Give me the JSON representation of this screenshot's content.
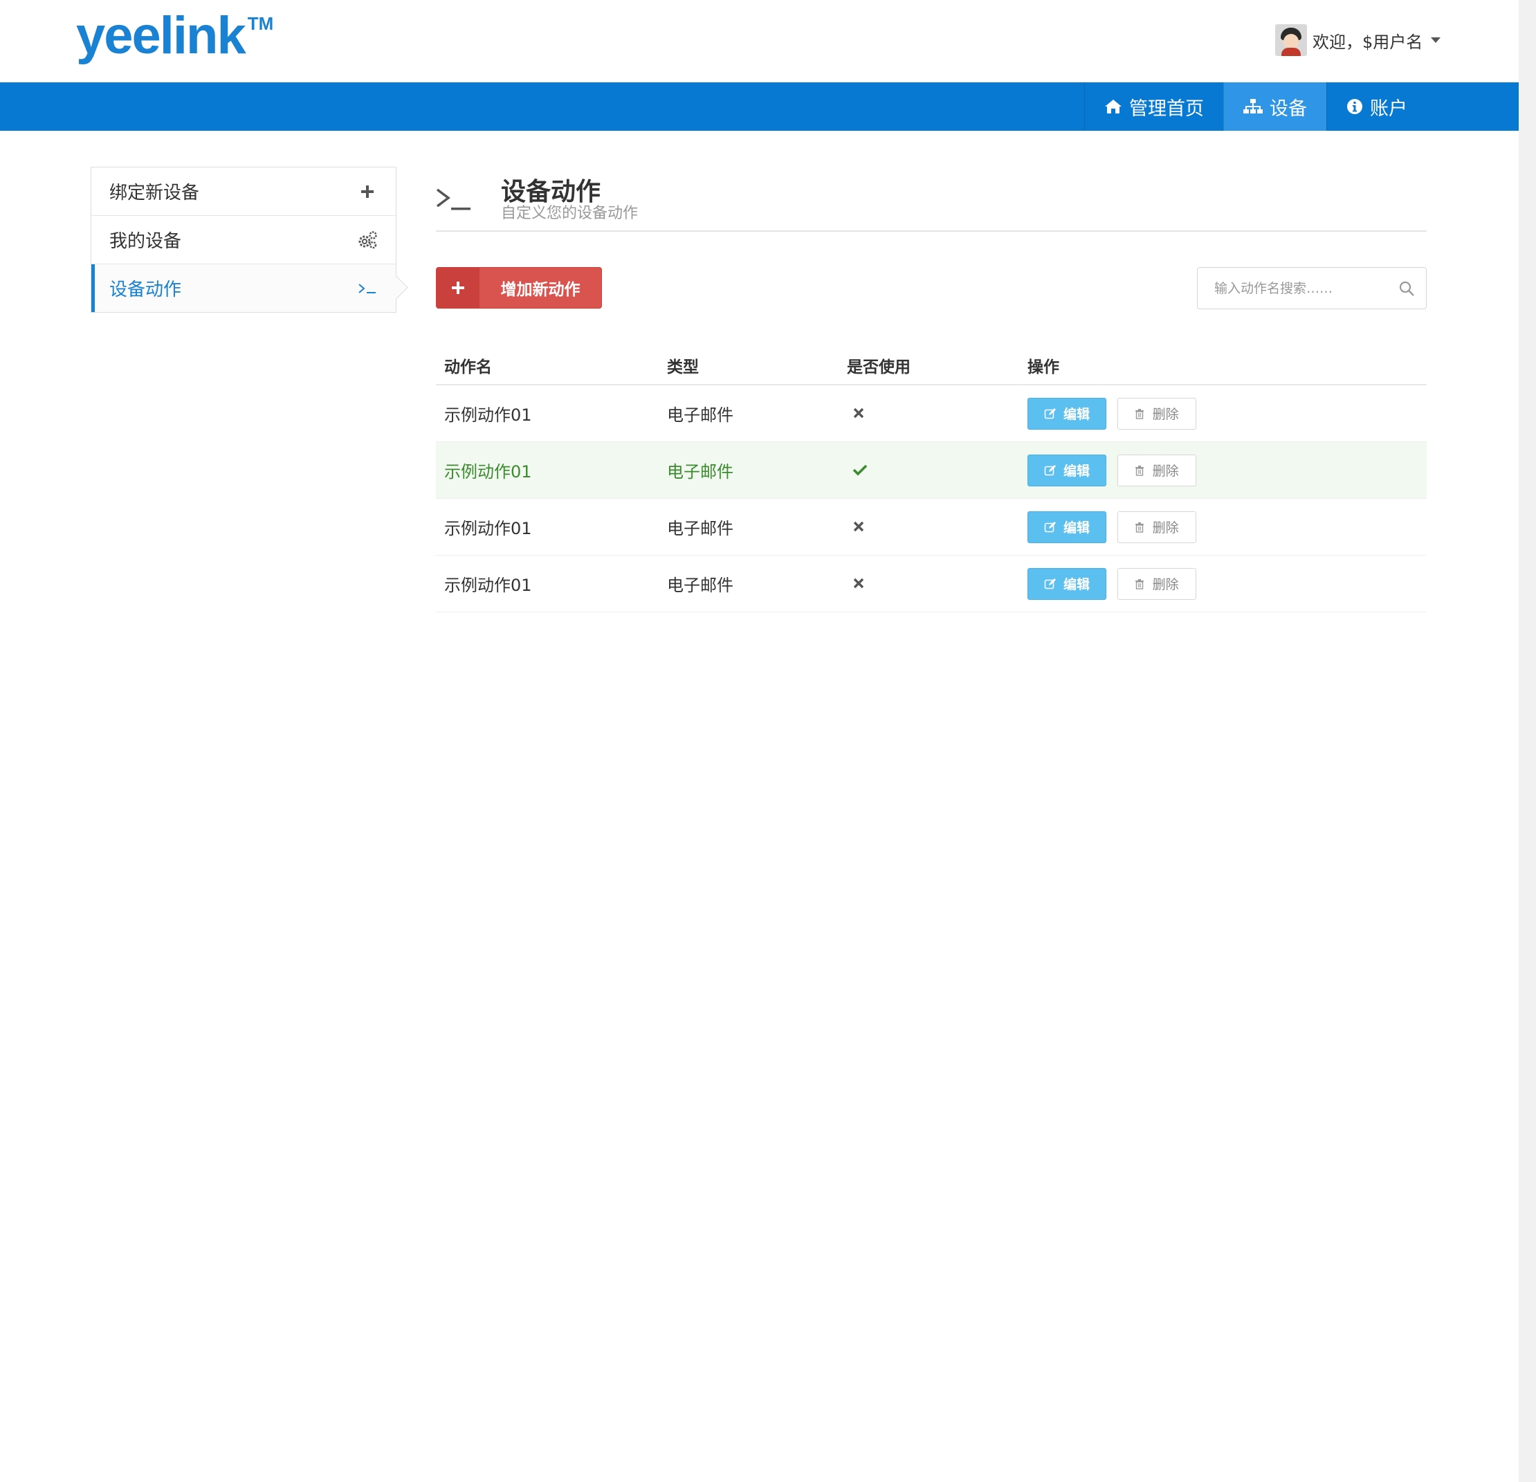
{
  "brand": {
    "logo_text": "yeelink",
    "trademark": "TM"
  },
  "user": {
    "greeting": "欢迎，$用户名"
  },
  "nav": {
    "items": [
      {
        "label": "管理首页",
        "icon": "home-icon"
      },
      {
        "label": "设备",
        "icon": "sitemap-icon",
        "active": true
      },
      {
        "label": "账户",
        "icon": "info-circle-icon"
      }
    ]
  },
  "sidebar": {
    "items": [
      {
        "label": "绑定新设备",
        "icon": "plus-icon"
      },
      {
        "label": "我的设备",
        "icon": "gears-icon"
      },
      {
        "label": "设备动作",
        "icon": "terminal-icon",
        "active": true
      }
    ]
  },
  "page": {
    "title": "设备动作",
    "subtitle": "自定义您的设备动作",
    "icon": "terminal-icon"
  },
  "toolbar": {
    "add_label": "增加新动作",
    "search_placeholder": "输入动作名搜索……"
  },
  "table": {
    "headers": [
      "动作名",
      "类型",
      "是否使用",
      "操作"
    ],
    "rows": [
      {
        "name": "示例动作01",
        "type": "电子邮件",
        "used": false
      },
      {
        "name": "示例动作01",
        "type": "电子邮件",
        "used": true
      },
      {
        "name": "示例动作01",
        "type": "电子邮件",
        "used": false
      },
      {
        "name": "示例动作01",
        "type": "电子邮件",
        "used": false
      }
    ],
    "edit_label": "编辑",
    "delete_label": "删除"
  },
  "colors": {
    "brand_blue": "#0879d3",
    "danger": "#d9534f",
    "info": "#5bc0ef",
    "success_text": "#3c8a2e"
  }
}
